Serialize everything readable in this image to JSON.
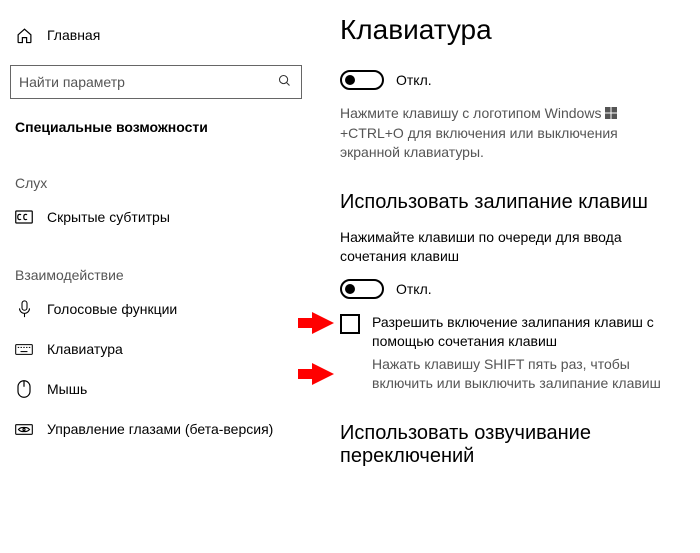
{
  "sidebar": {
    "home": "Главная",
    "search_placeholder": "Найти параметр",
    "heading": "Специальные возможности",
    "group1": "Слух",
    "cc": "Скрытые субтитры",
    "group2": "Взаимодействие",
    "voice": "Голосовые функции",
    "keyboard": "Клавиатура",
    "mouse": "Мышь",
    "eye": "Управление глазами (бета-версия)"
  },
  "main": {
    "title": "Клавиатура",
    "toggle_off_1": "Откл.",
    "shortcut_hint_a": "Нажмите клавишу с логотипом Windows ",
    "shortcut_hint_b": " +CTRL+O для включения или выключения экранной клавиатуры.",
    "sticky_heading": "Использовать залипание клавиш",
    "sticky_desc": "Нажимайте клавиши по очереди для ввода сочетания клавиш",
    "toggle_off_2": "Откл.",
    "cb_label": "Разрешить включение залипания клавиш с помощью сочетания клавиш",
    "cb_hint": "Нажать клавишу SHIFT пять раз, чтобы включить или выключить залипание клавиш",
    "sound_heading": "Использовать озвучивание переключений"
  }
}
